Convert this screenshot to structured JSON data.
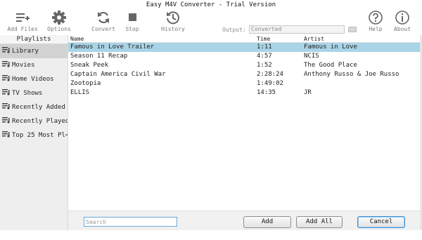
{
  "window": {
    "title": "Easy M4V Converter - Trial Version"
  },
  "toolbar": {
    "add_files": "Add Files",
    "options": "Options",
    "convert": "Convert",
    "stop": "Stop",
    "history": "History",
    "output_label": "Output:",
    "output_value": "Converted",
    "help": "Help",
    "about": "About"
  },
  "sidebar": {
    "header": "Playlists",
    "items": [
      {
        "label": "Library"
      },
      {
        "label": "Movies"
      },
      {
        "label": "Home Videos"
      },
      {
        "label": "TV Shows"
      },
      {
        "label": "Recently Added"
      },
      {
        "label": "Recently Played"
      },
      {
        "label": "Top 25 Most Pl⋯"
      }
    ]
  },
  "table": {
    "columns": {
      "name": "Name",
      "time": "Time",
      "artist": "Artist"
    },
    "rows": [
      {
        "name": "Famous in Love  Trailer",
        "time": "1:11",
        "artist": "Famous in Love"
      },
      {
        "name": "Season 11 Recap",
        "time": "4:57",
        "artist": "NCIS"
      },
      {
        "name": "Sneak Peek",
        "time": "1:52",
        "artist": "The Good Place"
      },
      {
        "name": "Captain America  Civil War",
        "time": "2:28:24",
        "artist": "Anthony Russo & Joe Russo"
      },
      {
        "name": "Zootopia",
        "time": "1:49:02",
        "artist": ""
      },
      {
        "name": "ELLIS",
        "time": "14:35",
        "artist": "JR"
      }
    ]
  },
  "bottom": {
    "search_placeholder": "Search",
    "add": "Add",
    "add_all": "Add All",
    "cancel": "Cancel"
  },
  "colors": {
    "selection": "#a9d4e6",
    "sidebar_active": "#d2d2d2",
    "accent": "#3f8fd2"
  }
}
